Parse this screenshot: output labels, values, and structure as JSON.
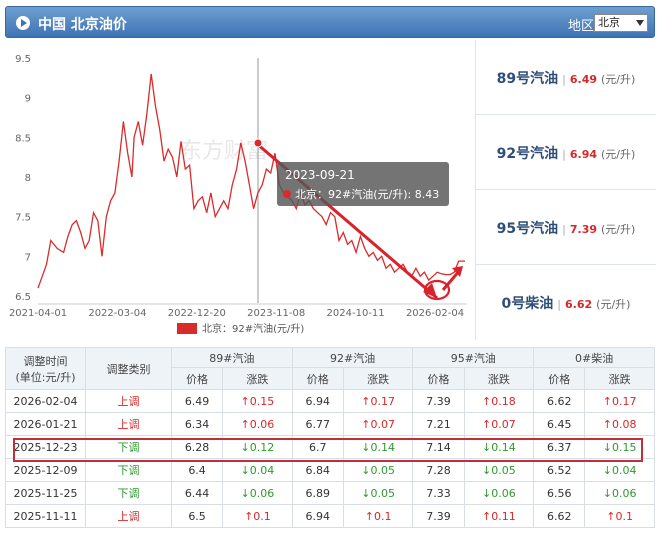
{
  "header": {
    "title": "中国 北京油价",
    "region_label": "地区",
    "region_value": "北京"
  },
  "chart_data": {
    "type": "line",
    "title": "",
    "xlabel": "",
    "ylabel": "",
    "ylim": [
      6.5,
      9.5
    ],
    "yticks": [
      "9.5",
      "9",
      "8.5",
      "8",
      "7.5",
      "7",
      "6.5"
    ],
    "xticks": [
      "2021-04-01",
      "2022-03-04",
      "2022-12-20",
      "2023-11-08",
      "2024-10-11",
      "2026-02-04"
    ],
    "legend": "北京：92#汽油(元/升)",
    "legend_position": "bottom",
    "watermark": "东方财富",
    "tooltip": {
      "date": "2023-09-21",
      "text": "北京：92#汽油(元/升): 8.43"
    },
    "series": [
      {
        "name": "北京：92#汽油(元/升)",
        "color": "#d92b2b",
        "x": [
          0.0,
          0.01,
          0.02,
          0.03,
          0.045,
          0.06,
          0.07,
          0.08,
          0.09,
          0.1,
          0.11,
          0.12,
          0.13,
          0.14,
          0.15,
          0.16,
          0.17,
          0.18,
          0.19,
          0.2,
          0.21,
          0.22,
          0.225,
          0.235,
          0.245,
          0.255,
          0.265,
          0.275,
          0.285,
          0.295,
          0.305,
          0.315,
          0.325,
          0.335,
          0.345,
          0.355,
          0.365,
          0.375,
          0.385,
          0.395,
          0.405,
          0.415,
          0.425,
          0.435,
          0.445,
          0.455,
          0.465,
          0.475,
          0.485,
          0.495,
          0.505,
          0.515,
          0.525,
          0.535,
          0.545,
          0.555,
          0.565,
          0.575,
          0.585,
          0.595,
          0.605,
          0.615,
          0.625,
          0.635,
          0.645,
          0.655,
          0.665,
          0.675,
          0.685,
          0.695,
          0.705,
          0.715,
          0.725,
          0.735,
          0.745,
          0.755,
          0.765,
          0.775,
          0.785,
          0.795,
          0.805,
          0.815,
          0.825,
          0.835,
          0.845,
          0.855,
          0.865,
          0.875,
          0.885,
          0.895,
          0.905,
          0.915,
          0.925,
          0.935,
          0.945,
          0.955,
          0.965,
          0.975,
          0.985,
          1.0
        ],
        "y": [
          6.6,
          6.75,
          6.9,
          7.2,
          7.1,
          7.05,
          7.25,
          7.4,
          7.45,
          7.3,
          7.1,
          7.2,
          7.55,
          7.45,
          7.0,
          7.5,
          7.7,
          7.8,
          8.2,
          8.7,
          8.3,
          8.0,
          8.5,
          8.7,
          8.4,
          8.8,
          9.3,
          8.9,
          8.6,
          8.2,
          8.35,
          8.25,
          8.0,
          8.45,
          8.1,
          8.15,
          7.6,
          7.7,
          7.75,
          7.55,
          7.8,
          7.5,
          7.6,
          7.7,
          7.6,
          7.9,
          8.1,
          8.43,
          8.2,
          7.9,
          7.6,
          7.8,
          7.9,
          8.1,
          8.05,
          8.3,
          7.9,
          7.8,
          7.75,
          7.7,
          7.6,
          7.8,
          7.65,
          7.7,
          7.6,
          7.55,
          7.5,
          7.4,
          7.55,
          7.5,
          7.2,
          7.3,
          7.15,
          7.2,
          7.05,
          7.25,
          7.1,
          7.0,
          7.05,
          6.95,
          7.0,
          6.85,
          6.9,
          6.8,
          6.85,
          6.9,
          6.8,
          6.75,
          6.85,
          6.75,
          6.8,
          6.7,
          6.75,
          6.8,
          6.78,
          6.77,
          6.77,
          6.8,
          6.94,
          6.94
        ]
      }
    ]
  },
  "prices": [
    {
      "name": "89号汽油",
      "value": "6.49",
      "unit": "(元/升)"
    },
    {
      "name": "92号汽油",
      "value": "6.94",
      "unit": "(元/升)"
    },
    {
      "name": "95号汽油",
      "value": "7.39",
      "unit": "(元/升)"
    },
    {
      "name": "0号柴油",
      "value": "6.62",
      "unit": "(元/升)"
    }
  ],
  "table": {
    "col_time": "调整时间",
    "col_time_unit": "(单位:元/升)",
    "col_type": "调整类别",
    "groups": [
      "89#汽油",
      "92#汽油",
      "95#汽油",
      "0#柴油"
    ],
    "sub_price": "价格",
    "sub_change": "涨跌",
    "rows": [
      {
        "date": "2026-02-04",
        "type": "上调",
        "dir": "up",
        "v": [
          "6.49",
          "↑0.15",
          "6.94",
          "↑0.17",
          "7.39",
          "↑0.18",
          "6.62",
          "↑0.17"
        ]
      },
      {
        "date": "2026-01-21",
        "type": "上调",
        "dir": "up",
        "v": [
          "6.34",
          "↑0.06",
          "6.77",
          "↑0.07",
          "7.21",
          "↑0.07",
          "6.45",
          "↑0.08"
        ]
      },
      {
        "date": "2025-12-23",
        "type": "下调",
        "dir": "down",
        "v": [
          "6.28",
          "↓0.12",
          "6.7",
          "↓0.14",
          "7.14",
          "↓0.14",
          "6.37",
          "↓0.15"
        ]
      },
      {
        "date": "2025-12-09",
        "type": "下调",
        "dir": "down",
        "v": [
          "6.4",
          "↓0.04",
          "6.84",
          "↓0.05",
          "7.28",
          "↓0.05",
          "6.52",
          "↓0.04"
        ]
      },
      {
        "date": "2025-11-25",
        "type": "下调",
        "dir": "down",
        "v": [
          "6.44",
          "↓0.06",
          "6.89",
          "↓0.05",
          "7.33",
          "↓0.06",
          "6.56",
          "↓0.06"
        ]
      },
      {
        "date": "2025-11-11",
        "type": "上调",
        "dir": "up",
        "v": [
          "6.5",
          "↑0.1",
          "6.94",
          "↑0.1",
          "7.39",
          "↑0.11",
          "6.62",
          "↑0.1"
        ]
      }
    ]
  }
}
